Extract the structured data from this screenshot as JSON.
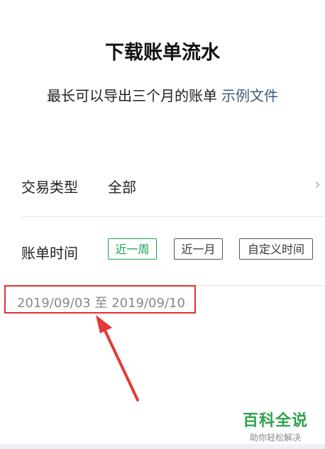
{
  "header": {
    "title": "下载账单流水",
    "subtitle": "最长可以导出三个月的账单",
    "example_link": "示例文件"
  },
  "transaction_type": {
    "label": "交易类型",
    "value": "全部"
  },
  "bill_time": {
    "label": "账单时间",
    "options": [
      "近一周",
      "近一月",
      "自定义时间"
    ],
    "selected": "近一周"
  },
  "date_range": {
    "text": "2019/09/03 至 2019/09/10"
  },
  "watermark": {
    "main": "百科全说",
    "sub": "助你轻松解决"
  },
  "colors": {
    "accent_green": "#1aa24a",
    "link_blue": "#3c5a7c",
    "annotation_red": "#e03030"
  },
  "icons": {
    "chevron": "chevron-right-icon",
    "arrow": "annotation-arrow-icon"
  }
}
